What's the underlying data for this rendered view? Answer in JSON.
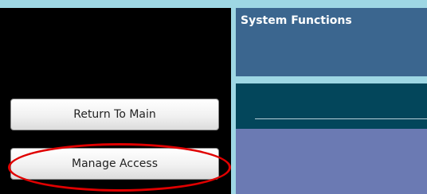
{
  "window": {
    "section_title": "System Functions"
  },
  "sidebar": {
    "buttons": [
      {
        "label": "Return To Main"
      },
      {
        "label": "Manage Access"
      }
    ]
  },
  "colors": {
    "top_strip": "#9ed7e4",
    "header_panel": "#3b668f",
    "band_panel": "#03465b",
    "content_panel": "#6b7ab3",
    "highlight": "#e00000"
  }
}
